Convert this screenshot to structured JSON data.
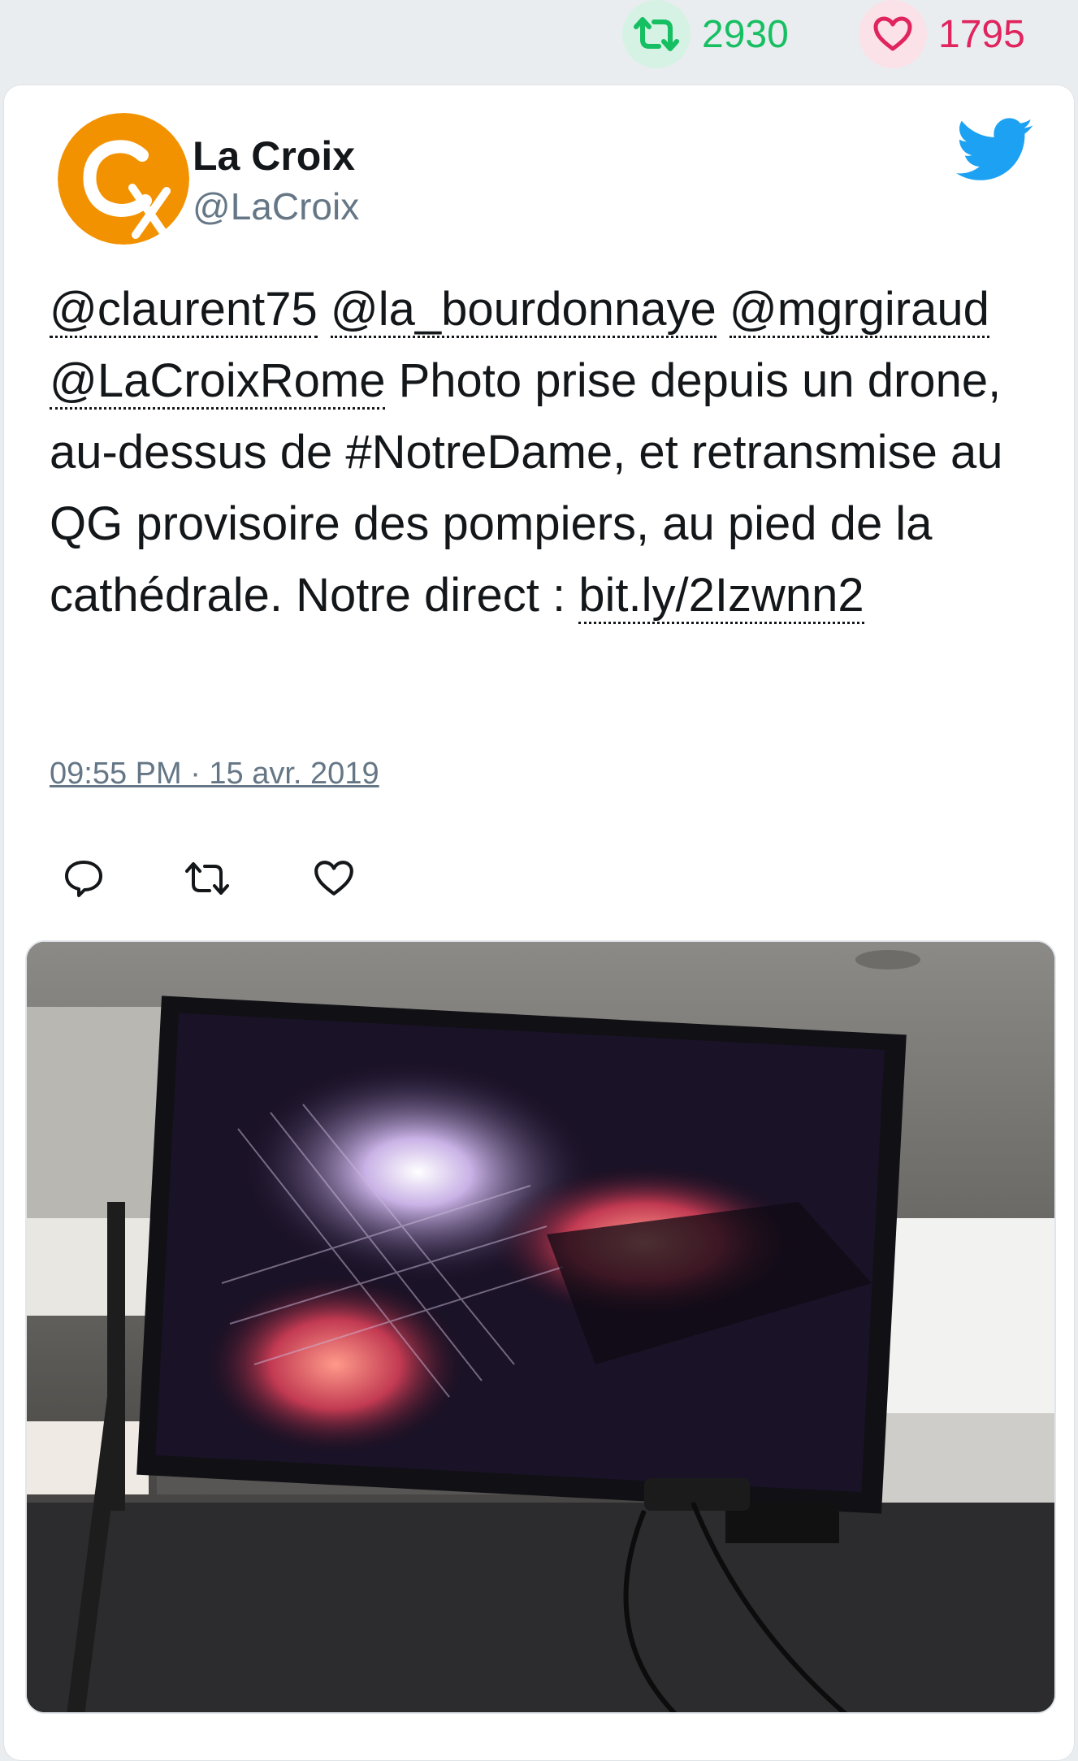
{
  "stats": {
    "retweets": "2930",
    "likes": "1795",
    "retweet_color": "#17bf63",
    "like_color": "#e0245e"
  },
  "tweet": {
    "author_name": "La Croix",
    "author_handle": "@LaCroix",
    "avatar_icon": "la-croix-logo",
    "platform_icon": "twitter-bird-icon",
    "mentions": [
      "@claurent75",
      "@la_bourdonnaye",
      "@mgrgiraud",
      "@LaCroixRome"
    ],
    "text_part1": " Photo prise depuis un drone, au-dessus de #NotreDame, et retransmise au QG provisoire des pompiers, au pied de la cathédrale. Notre direct : ",
    "link": "bit.ly/2Izwnn2",
    "timestamp": "09:55 PM · 15 avr. 2019",
    "actions": [
      "reply-icon",
      "retweet-icon",
      "like-icon"
    ]
  }
}
